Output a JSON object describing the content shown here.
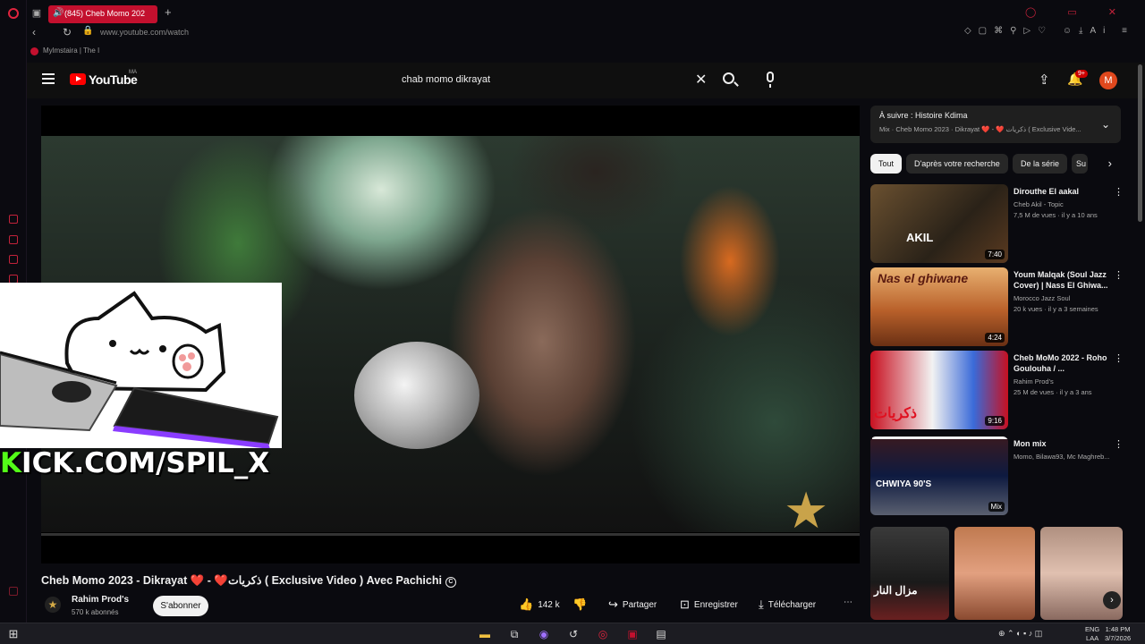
{
  "browser": {
    "tab_title": "(845) Cheb Momo 202",
    "url": "www.youtube.com/watch",
    "bookmark": "Mylmstaira | The I"
  },
  "youtube": {
    "logo_text": "YouTube",
    "country_code": "MA",
    "search_query": "chab momo dikrayat",
    "notification_count": "9+",
    "avatar_letter": "M"
  },
  "player": {
    "progress_fraction": 0.0,
    "overlay_text_k": "K",
    "overlay_text_rest": "ICK.COM/SPIL_X"
  },
  "video": {
    "title_part1": "Cheb Momo 2023 - Dikrayat ",
    "title_heart1": "❤️",
    "title_mid": " - ",
    "title_heart2": "❤️",
    "title_part2": "ذكريات ( Exclusive Video ) Avec Pachichi",
    "verified_mark": "C",
    "channel_name": "Rahim Prod's",
    "channel_subs": "570 k abonnés",
    "subscribe_label": "S'abonner",
    "likes": "142 k",
    "share_label": "Partager",
    "save_label": "Enregistrer",
    "download_label": "Télécharger"
  },
  "queue": {
    "next_label": "À suivre : Histoire Kdima",
    "playlist_meta": "Mix · Cheb Momo 2023 · Dikrayat ❤️ - ❤️ ذكريات ( Exclusive Vide..."
  },
  "chips": [
    "Tout",
    "D'après votre recherche",
    "De la série",
    "Su"
  ],
  "recommendations": [
    {
      "title": "Dirouthe El aakal",
      "channel": "Cheb Akil - Topic",
      "meta": "7,5 M de vues · il y a 10 ans",
      "duration": "7:40"
    },
    {
      "title": "Youm Malqak (Soul Jazz Cover) | Nass El Ghiwa...",
      "channel": "Morocco Jazz Soul",
      "meta": "20 k vues · il y a 3 semaines",
      "duration": "4:24"
    },
    {
      "title": "Cheb MoMo 2022 - Roho Goulouha / ...",
      "channel": "Rahim Prod's",
      "meta": "25 M de vues · il y a 3 ans",
      "duration": "9:16"
    },
    {
      "title": "Mon mix",
      "channel": "Momo, Bilawa93, Mc Maghreb...",
      "meta": "",
      "duration": "Mix"
    }
  ],
  "taskbar": {
    "lang_top": "ENG",
    "lang_bottom": "LAA",
    "time": "1:48 PM",
    "date": "3/7/2026"
  },
  "colors": {
    "yt_red": "#ff0000",
    "gx_red": "#c3102e",
    "kick_green": "#53fc18"
  },
  "icons": [
    "search-icon",
    "mic-icon",
    "upload-icon",
    "bell-icon",
    "like-icon",
    "dislike-icon",
    "share-icon",
    "save-icon",
    "download-icon",
    "more-icon",
    "windows-start-icon"
  ]
}
